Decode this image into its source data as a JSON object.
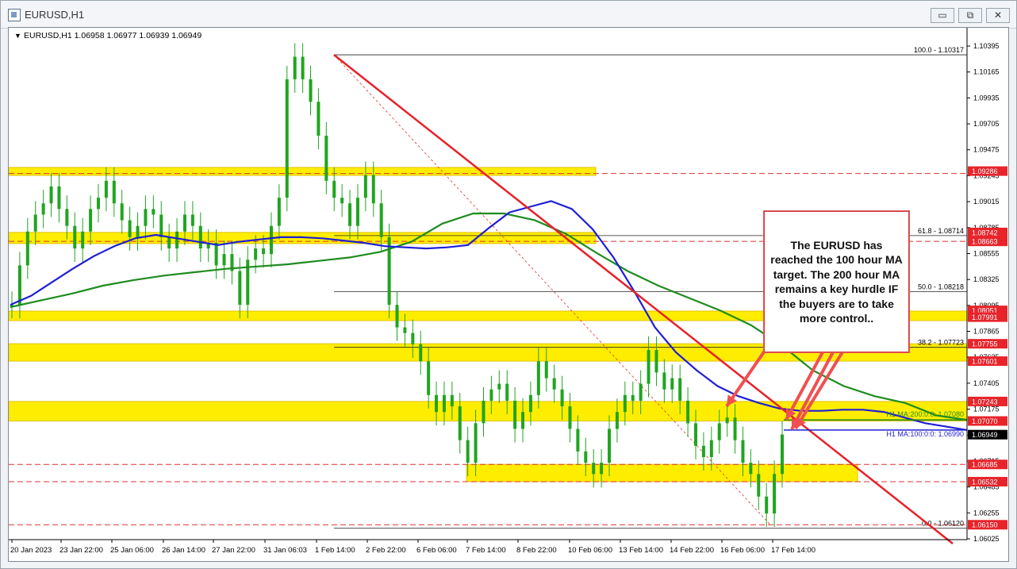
{
  "window": {
    "title": "EURUSD,H1",
    "buttons": {
      "minimize": "▭",
      "restore": "⧉",
      "close": "✕"
    }
  },
  "header": {
    "collapse_glyph": "▼",
    "info": "EURUSD,H1  1.06958 1.06977 1.06939 1.06949"
  },
  "annotation": {
    "text": "The EURUSD has reached the 100 hour MA target. The 200 hour MA remains a key hurdle IF the buyers are to take more control.."
  },
  "colors": {
    "zone_fill": "#ffed00",
    "zone_border": "#e0c200",
    "trendline": "#e8202a",
    "dash_red": "#e03030",
    "ma100": "#1f1fd6",
    "ma200": "#1e8c1e",
    "candles": "#1fa51f",
    "level_tag": "#e8242b",
    "price_tag": "#000000",
    "arrow": "#f05050"
  },
  "chart_data": {
    "type": "candlestick",
    "symbol": "EURUSD",
    "timeframe": "H1",
    "ylim": [
      1.06025,
      1.10395
    ],
    "y_ticks": [
      "1.10395",
      "1.10165",
      "1.09935",
      "1.09705",
      "1.09475",
      "1.09245",
      "1.09015",
      "1.08785",
      "1.08555",
      "1.08325",
      "1.08095",
      "1.07865",
      "1.07635",
      "1.07405",
      "1.07175",
      "1.06945",
      "1.06715",
      "1.06485",
      "1.06255",
      "1.06025"
    ],
    "x_ticks": [
      "20 Jan 2023",
      "23 Jan 22:00",
      "25 Jan 06:00",
      "26 Jan 14:00",
      "27 Jan 22:00",
      "31 Jan 06:03",
      "1 Feb 14:00",
      "2 Feb 22:00",
      "6 Feb 06:00",
      "7 Feb 14:00",
      "8 Feb 22:00",
      "10 Feb 06:00",
      "13 Feb 14:00",
      "14 Feb 22:00",
      "16 Feb 06:00",
      "17 Feb 14:00"
    ],
    "price_series": [
      1.081,
      1.0845,
      1.0875,
      1.089,
      1.09,
      1.0915,
      1.0895,
      1.088,
      1.086,
      1.0875,
      1.0895,
      1.0905,
      1.092,
      1.09,
      1.0885,
      1.087,
      1.088,
      1.0895,
      1.089,
      1.087,
      1.086,
      1.0875,
      1.089,
      1.088,
      1.086,
      1.0865,
      1.0845,
      1.0855,
      1.084,
      1.081,
      1.085,
      1.086,
      1.0855,
      1.088,
      1.0905,
      1.101,
      1.103,
      1.101,
      1.099,
      1.096,
      1.092,
      1.0905,
      1.09,
      1.088,
      1.0905,
      1.0925,
      1.09,
      1.087,
      1.081,
      1.079,
      1.0785,
      1.0775,
      1.076,
      1.073,
      1.0715,
      1.073,
      1.072,
      1.069,
      1.067,
      1.0705,
      1.0725,
      1.0735,
      1.074,
      1.0725,
      1.07,
      1.0715,
      1.073,
      1.076,
      1.0745,
      1.0735,
      1.072,
      1.07,
      1.068,
      1.067,
      1.066,
      1.067,
      1.07,
      1.0715,
      1.073,
      1.0725,
      1.074,
      1.077,
      1.075,
      1.0735,
      1.0745,
      1.0725,
      1.0705,
      1.0685,
      1.0675,
      1.069,
      1.0705,
      1.071,
      1.069,
      1.067,
      1.066,
      1.064,
      1.0625,
      1.066,
      1.0695
    ],
    "ma100": [
      1.081,
      1.0818,
      1.083,
      1.0842,
      1.0853,
      1.0862,
      1.0869,
      1.0872,
      1.0869,
      1.0866,
      1.0863,
      1.0866,
      1.0868,
      1.087,
      1.087,
      1.0869,
      1.0867,
      1.0865,
      1.0862,
      1.0861,
      1.086,
      1.0861,
      1.0863,
      1.0878,
      1.0892,
      1.0897,
      1.0902,
      1.0895,
      1.0877,
      1.0852,
      1.0822,
      1.079,
      1.0768,
      1.0752,
      1.0738,
      1.0729,
      1.0723,
      1.0718,
      1.0716,
      1.0716,
      1.0717,
      1.0717,
      1.0715,
      1.071,
      1.0705,
      1.0702,
      1.0699
    ],
    "ma200": [
      1.0808,
      1.0814,
      1.082,
      1.0827,
      1.0832,
      1.0836,
      1.0839,
      1.0842,
      1.0844,
      1.0846,
      1.0849,
      1.0852,
      1.0857,
      1.0866,
      1.0882,
      1.0891,
      1.0891,
      1.0885,
      1.0873,
      1.0856,
      1.084,
      1.0827,
      1.0816,
      1.0805,
      1.0792,
      1.0774,
      1.0752,
      1.0738,
      1.0729,
      1.0723,
      1.0712,
      1.0708
    ],
    "zones": [
      {
        "low": 1.09255,
        "high": 1.09286
      },
      {
        "low": 1.08663,
        "high": 1.08742
      },
      {
        "low": 1.07991,
        "high": 1.08051
      },
      {
        "low": 1.07601,
        "high": 1.07755
      },
      {
        "low": 1.0707,
        "high": 1.07243
      },
      {
        "low": 1.06532,
        "high": 1.06685
      }
    ],
    "fibonacci": [
      {
        "label": "100.0 - 1.10317",
        "price": 1.10317
      },
      {
        "label": "61.8 - 1.08714",
        "price": 1.08714
      },
      {
        "label": "50.0 - 1.08218",
        "price": 1.08218
      },
      {
        "label": "38.2 - 1.07723",
        "price": 1.07723
      },
      {
        "label": "0.0 - 1.06120",
        "price": 1.0612
      }
    ],
    "trendline": {
      "from": {
        "x": "1 Feb 14:00",
        "y": 1.10317
      },
      "to": {
        "x": "17 Feb 14:00",
        "y": 1.0699
      }
    },
    "ma_labels": [
      {
        "name": "H1 MA:200:0:0: 1.07080",
        "price": 1.0708
      },
      {
        "name": "H1 MA:100:0:0: 1.06990",
        "price": 1.0699
      }
    ],
    "level_tags": [
      "1.09286",
      "1.08742",
      "1.08663",
      "1.08051",
      "1.07991",
      "1.07755",
      "1.07601",
      "1.07243",
      "1.07070",
      "1.06685",
      "1.06532",
      "1.06150"
    ],
    "current_price": "1.06949"
  }
}
